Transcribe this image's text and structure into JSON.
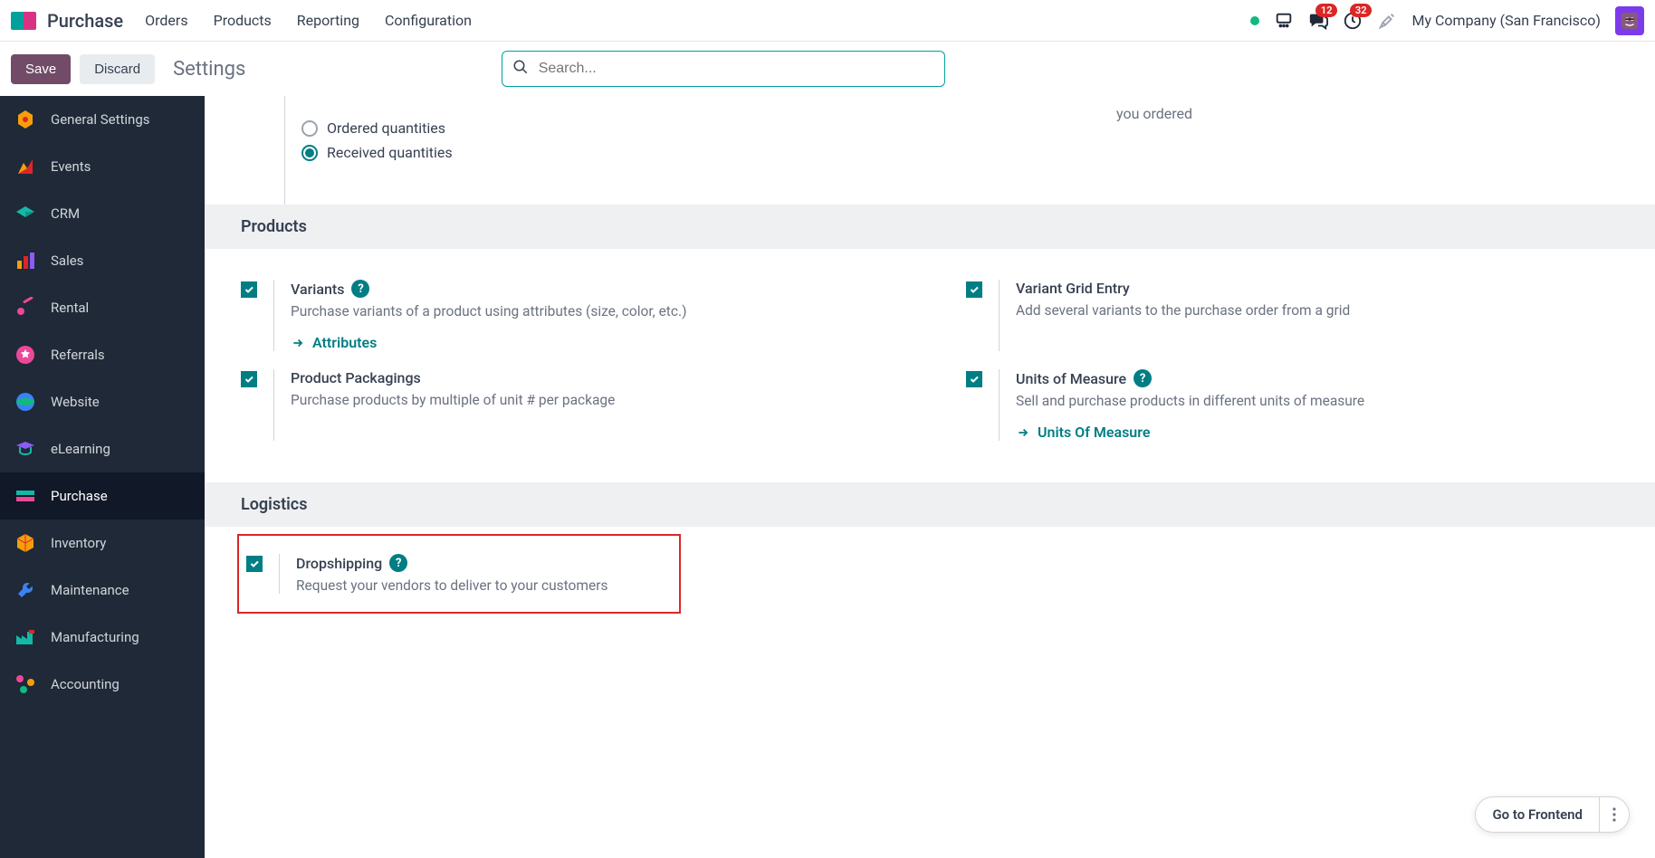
{
  "navbar": {
    "app": "Purchase",
    "menu": [
      "Orders",
      "Products",
      "Reporting",
      "Configuration"
    ],
    "badges": {
      "messages": "12",
      "activities": "32"
    },
    "company": "My Company (San Francisco)"
  },
  "controlbar": {
    "save": "Save",
    "discard": "Discard",
    "title": "Settings",
    "search_placeholder": "Search..."
  },
  "sidebar": {
    "items": [
      {
        "label": "General Settings"
      },
      {
        "label": "Events"
      },
      {
        "label": "CRM"
      },
      {
        "label": "Sales"
      },
      {
        "label": "Rental"
      },
      {
        "label": "Referrals"
      },
      {
        "label": "Website"
      },
      {
        "label": "eLearning"
      },
      {
        "label": "Purchase"
      },
      {
        "label": "Inventory"
      },
      {
        "label": "Maintenance"
      },
      {
        "label": "Manufacturing"
      },
      {
        "label": "Accounting"
      }
    ]
  },
  "partial": {
    "ordered": "Ordered quantities",
    "received": "Received quantities",
    "right_fragment": "you ordered"
  },
  "sections": {
    "products": {
      "header": "Products",
      "variants": {
        "title": "Variants",
        "desc": "Purchase variants of a product using attributes (size, color, etc.)",
        "link": "Attributes"
      },
      "grid_entry": {
        "title": "Variant Grid Entry",
        "desc": "Add several variants to the purchase order from a grid"
      },
      "packagings": {
        "title": "Product Packagings",
        "desc": "Purchase products by multiple of unit # per package"
      },
      "uom": {
        "title": "Units of Measure",
        "desc": "Sell and purchase products in different units of measure",
        "link": "Units Of Measure"
      }
    },
    "logistics": {
      "header": "Logistics",
      "dropship": {
        "title": "Dropshipping",
        "desc": "Request your vendors to deliver to your customers"
      }
    }
  },
  "frontend": {
    "label": "Go to Frontend"
  }
}
